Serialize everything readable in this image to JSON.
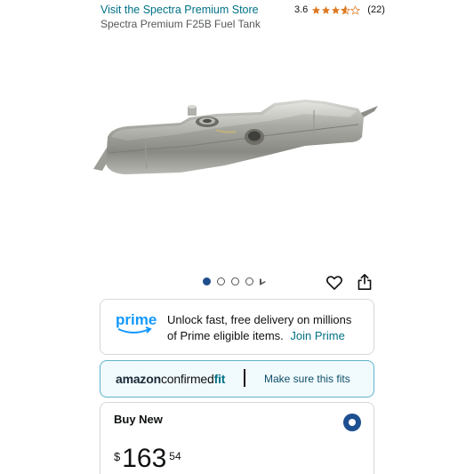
{
  "header": {
    "store_link": "Visit the Spectra Premium Store",
    "rating_value": "3.6",
    "rating_stars": 3.6,
    "rating_count": "(22)",
    "product_title": "Spectra Premium F25B Fuel Tank"
  },
  "carousel": {
    "image_icon": "fuel-tank-image",
    "total_images": 4,
    "active_index": 0
  },
  "actions": {
    "heart_icon": "heart-icon",
    "share_icon": "share-icon"
  },
  "prime": {
    "logo_text": "prime",
    "line1": "Unlock fast, free delivery on millions",
    "line2": "of Prime eligible items.",
    "join_label": "Join Prime",
    "brand_color": "#1399ff"
  },
  "confirmed_fit": {
    "logo_part1": "amazon",
    "logo_part2": "confirmed",
    "logo_part3": "fit",
    "link_label": "Make sure this fits",
    "border_color": "#5fb3c9"
  },
  "buy_new": {
    "title": "Buy New",
    "price_symbol": "$",
    "price_whole": "163",
    "price_fraction": "54",
    "radio_color": "#1d4f91"
  }
}
